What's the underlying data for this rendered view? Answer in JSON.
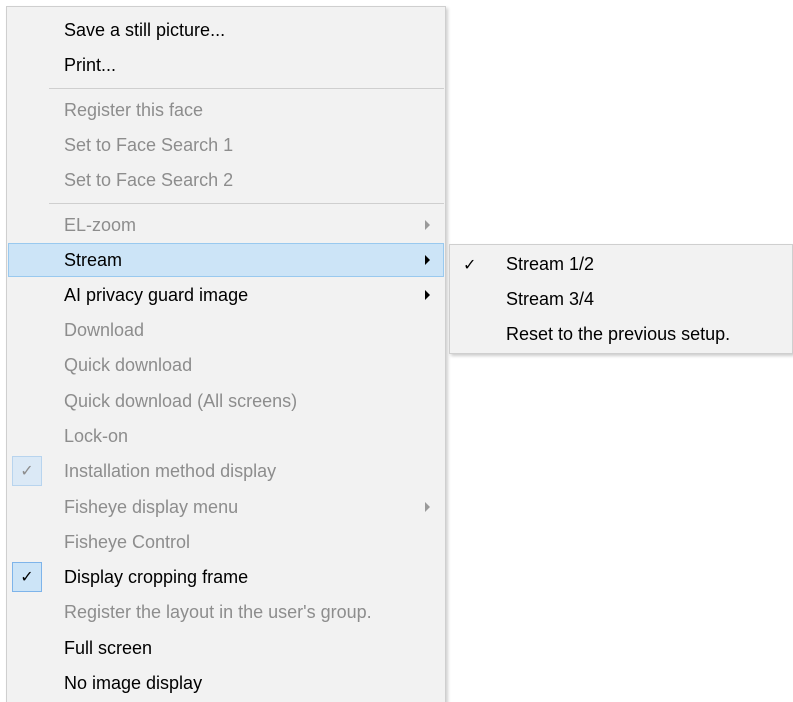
{
  "main_menu": {
    "items": [
      {
        "label": "Save a still picture...",
        "disabled": false
      },
      {
        "label": "Print...",
        "disabled": false
      },
      {
        "label": "Register this face",
        "disabled": true
      },
      {
        "label": "Set to Face Search 1",
        "disabled": true
      },
      {
        "label": "Set to Face Search 2",
        "disabled": true
      },
      {
        "label": "EL-zoom",
        "disabled": true,
        "submenu": true
      },
      {
        "label": "Stream",
        "disabled": false,
        "submenu": true,
        "highlighted": true
      },
      {
        "label": "AI privacy guard image",
        "disabled": false,
        "submenu": true
      },
      {
        "label": "Download",
        "disabled": true
      },
      {
        "label": "Quick download",
        "disabled": true
      },
      {
        "label": "Quick download (All screens)",
        "disabled": true
      },
      {
        "label": "Lock-on",
        "disabled": true
      },
      {
        "label": "Installation method display",
        "disabled": true,
        "checked": true
      },
      {
        "label": "Fisheye display menu",
        "disabled": true,
        "submenu": true
      },
      {
        "label": "Fisheye Control",
        "disabled": true
      },
      {
        "label": "Display cropping frame",
        "disabled": false,
        "checked": true
      },
      {
        "label": "Register the layout in the user's group.",
        "disabled": true
      },
      {
        "label": "Full screen",
        "disabled": false
      },
      {
        "label": "No image display",
        "disabled": false
      }
    ],
    "check_glyph": "✓"
  },
  "stream_submenu": {
    "items": [
      {
        "label": "Stream 1/2",
        "checked": true
      },
      {
        "label": "Stream 3/4",
        "checked": false
      },
      {
        "label": "Reset to the previous setup.",
        "checked": false
      }
    ],
    "check_glyph": "✓"
  },
  "colors": {
    "menu_bg": "#f2f2f2",
    "highlight_bg": "#cce4f7",
    "highlight_border": "#99c9ef",
    "disabled_text": "#8d8d8d"
  }
}
